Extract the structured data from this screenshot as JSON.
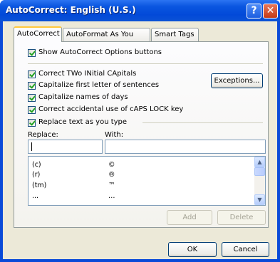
{
  "window": {
    "title": "AutoCorrect: English (U.S.)",
    "help_glyph": "?",
    "close_glyph": "✕"
  },
  "tabs": [
    {
      "label": "AutoCorrect",
      "active": true
    },
    {
      "label": "AutoFormat As You Type",
      "active": false
    },
    {
      "label": "Smart Tags",
      "active": false
    }
  ],
  "options": {
    "show_buttons": {
      "label": "Show AutoCorrect Options buttons",
      "checked": true
    },
    "two_initial_caps": {
      "label": "Correct TWo INitial CApitals",
      "checked": true
    },
    "first_letter": {
      "label": "Capitalize first letter of sentences",
      "checked": true
    },
    "names_of_days": {
      "label": "Capitalize names of days",
      "checked": true
    },
    "caps_lock": {
      "label": "Correct accidental use of cAPS LOCK key",
      "checked": true
    },
    "replace_text": {
      "label": "Replace text as you type",
      "checked": true
    }
  },
  "buttons": {
    "exceptions": "Exceptions...",
    "add": "Add",
    "delete": "Delete",
    "ok": "OK",
    "cancel": "Cancel"
  },
  "replace": {
    "replace_label": "Replace:",
    "with_label": "With:",
    "replace_value": "",
    "with_value": ""
  },
  "entries": [
    {
      "replace": "(c)",
      "with": "©"
    },
    {
      "replace": "(r)",
      "with": "®"
    },
    {
      "replace": "(tm)",
      "with": "™"
    },
    {
      "replace": "...",
      "with": "…"
    }
  ],
  "colors": {
    "titlebar": "#0a56e0",
    "dialog_bg": "#ece9d8",
    "check_mark": "#21a121"
  }
}
